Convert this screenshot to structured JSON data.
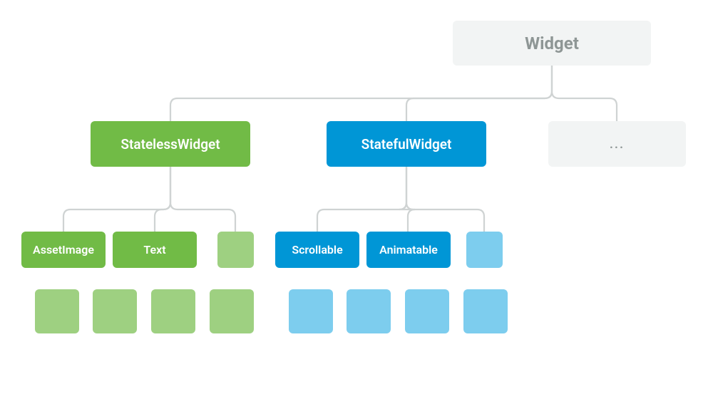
{
  "colors": {
    "root_bg": "#f2f4f4",
    "root_text": "#8e9695",
    "green_primary": "#71bb46",
    "green_light": "#9ed081",
    "blue_primary": "#0096d6",
    "blue_light": "#7dcdee",
    "connector": "#cfd3d3"
  },
  "tree": {
    "root": {
      "label": "Widget"
    },
    "level2": {
      "stateless": {
        "label": "StatelessWidget"
      },
      "stateful": {
        "label": "StatefulWidget"
      },
      "more": {
        "label": "..."
      }
    },
    "stateless_children": {
      "labeled": [
        "AssetImage",
        "Text"
      ],
      "unlabeled_light_count": 1,
      "row2_light_squares": 4
    },
    "stateful_children": {
      "labeled": [
        "Scrollable",
        "Animatable"
      ],
      "unlabeled_light_count": 1,
      "row2_light_squares": 4
    }
  }
}
